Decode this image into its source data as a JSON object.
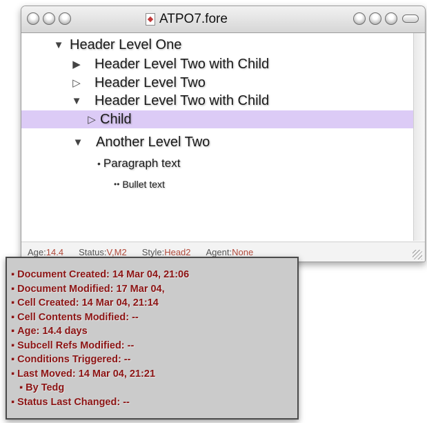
{
  "window": {
    "title": "ATPO7.fore"
  },
  "outline": {
    "rows": [
      {
        "label": "Header Level One",
        "toggle": "▼"
      },
      {
        "label": "Header Level Two with Child",
        "toggle": "▶"
      },
      {
        "label": "Header Level Two",
        "toggle": "▷"
      },
      {
        "label": "Header Level Two with Child",
        "toggle": "▼"
      },
      {
        "label": "Child",
        "toggle": "▷"
      },
      {
        "label": "Another Level Two",
        "toggle": "▼"
      },
      {
        "label": "Paragraph text",
        "bullet": "•"
      },
      {
        "label": "Bullet text",
        "bullet": "••"
      }
    ],
    "selected_row_color": "#dccbf6"
  },
  "statusbar": {
    "age_label": "Age:",
    "age_value": "14.4",
    "status_label": "Status:",
    "status_value": "V,M2",
    "style_label": "Style:",
    "style_value": "Head2",
    "agent_label": "Agent:",
    "agent_value": "None",
    "value_color": "#b24a3b"
  },
  "info": {
    "bullet": "▪",
    "lines": [
      "Document Created: 14 Mar 04, 21:06",
      "Document Modified: 17 Mar 04,",
      "Cell Created: 14 Mar 04, 21:14",
      "Cell Contents Modified: --",
      "Age: 14.4 days",
      "Subcell Refs Modified: --",
      "Conditions Triggered: --",
      "Last Moved: 14 Mar 04, 21:21",
      "By Tedg",
      "Status Last Changed: --"
    ],
    "text_color": "#8c1414"
  },
  "icons": {
    "title_doc": "document-icon",
    "resize": "resize-grip-icon"
  }
}
